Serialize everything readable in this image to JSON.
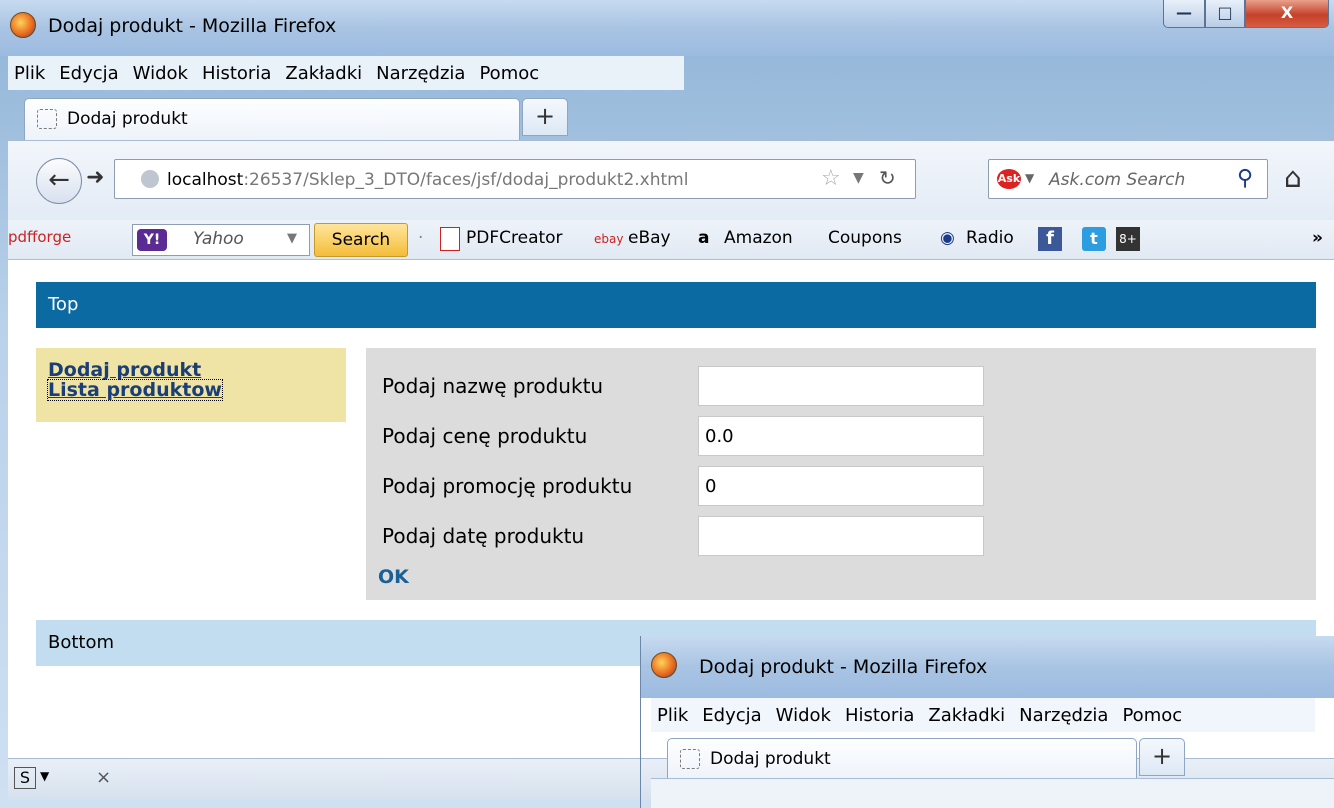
{
  "window": {
    "title": "Dodaj produkt - Mozilla Firefox",
    "controls": {
      "minimize": "—",
      "maximize": "□",
      "close": "X"
    }
  },
  "menu": [
    "Plik",
    "Edycja",
    "Widok",
    "Historia",
    "Zakładki",
    "Narzędzia",
    "Pomoc"
  ],
  "tab": {
    "label": "Dodaj produkt",
    "new_tab": "+"
  },
  "nav": {
    "url_host": "localhost",
    "url_rest": ":26537/Sklep_3_DTO/faces/jsf/dodaj_produkt2.xhtml",
    "search_placeholder": "Ask.com Search",
    "ask_logo": "Ask"
  },
  "bookmarks": {
    "pdfforge": "pdfforge",
    "yahoo_text": "Yahoo",
    "search_button": "Search",
    "pdfcreator": "PDFCreator",
    "ebay": "eBay",
    "amazon": "Amazon",
    "coupons": "Coupons",
    "radio": "Radio",
    "overflow": "»"
  },
  "page": {
    "top_banner": "Top",
    "bottom_banner": "Bottom",
    "sidebar": {
      "add_product": "Dodaj produkt",
      "product_list": "Lista produktow"
    },
    "form": {
      "fields": [
        {
          "label": "Podaj nazwę produktu",
          "value": ""
        },
        {
          "label": "Podaj cenę produktu",
          "value": "0.0"
        },
        {
          "label": "Podaj promocję produktu",
          "value": "0"
        },
        {
          "label": "Podaj datę produktu",
          "value": ""
        }
      ],
      "submit": "OK"
    }
  },
  "second_window": {
    "title": "Dodaj produkt - Mozilla Firefox",
    "menu": [
      "Plik",
      "Edycja",
      "Widok",
      "Historia",
      "Zakładki",
      "Narzędzia",
      "Pomoc"
    ],
    "tab": {
      "label": "Dodaj produkt",
      "new_tab": "+"
    }
  }
}
